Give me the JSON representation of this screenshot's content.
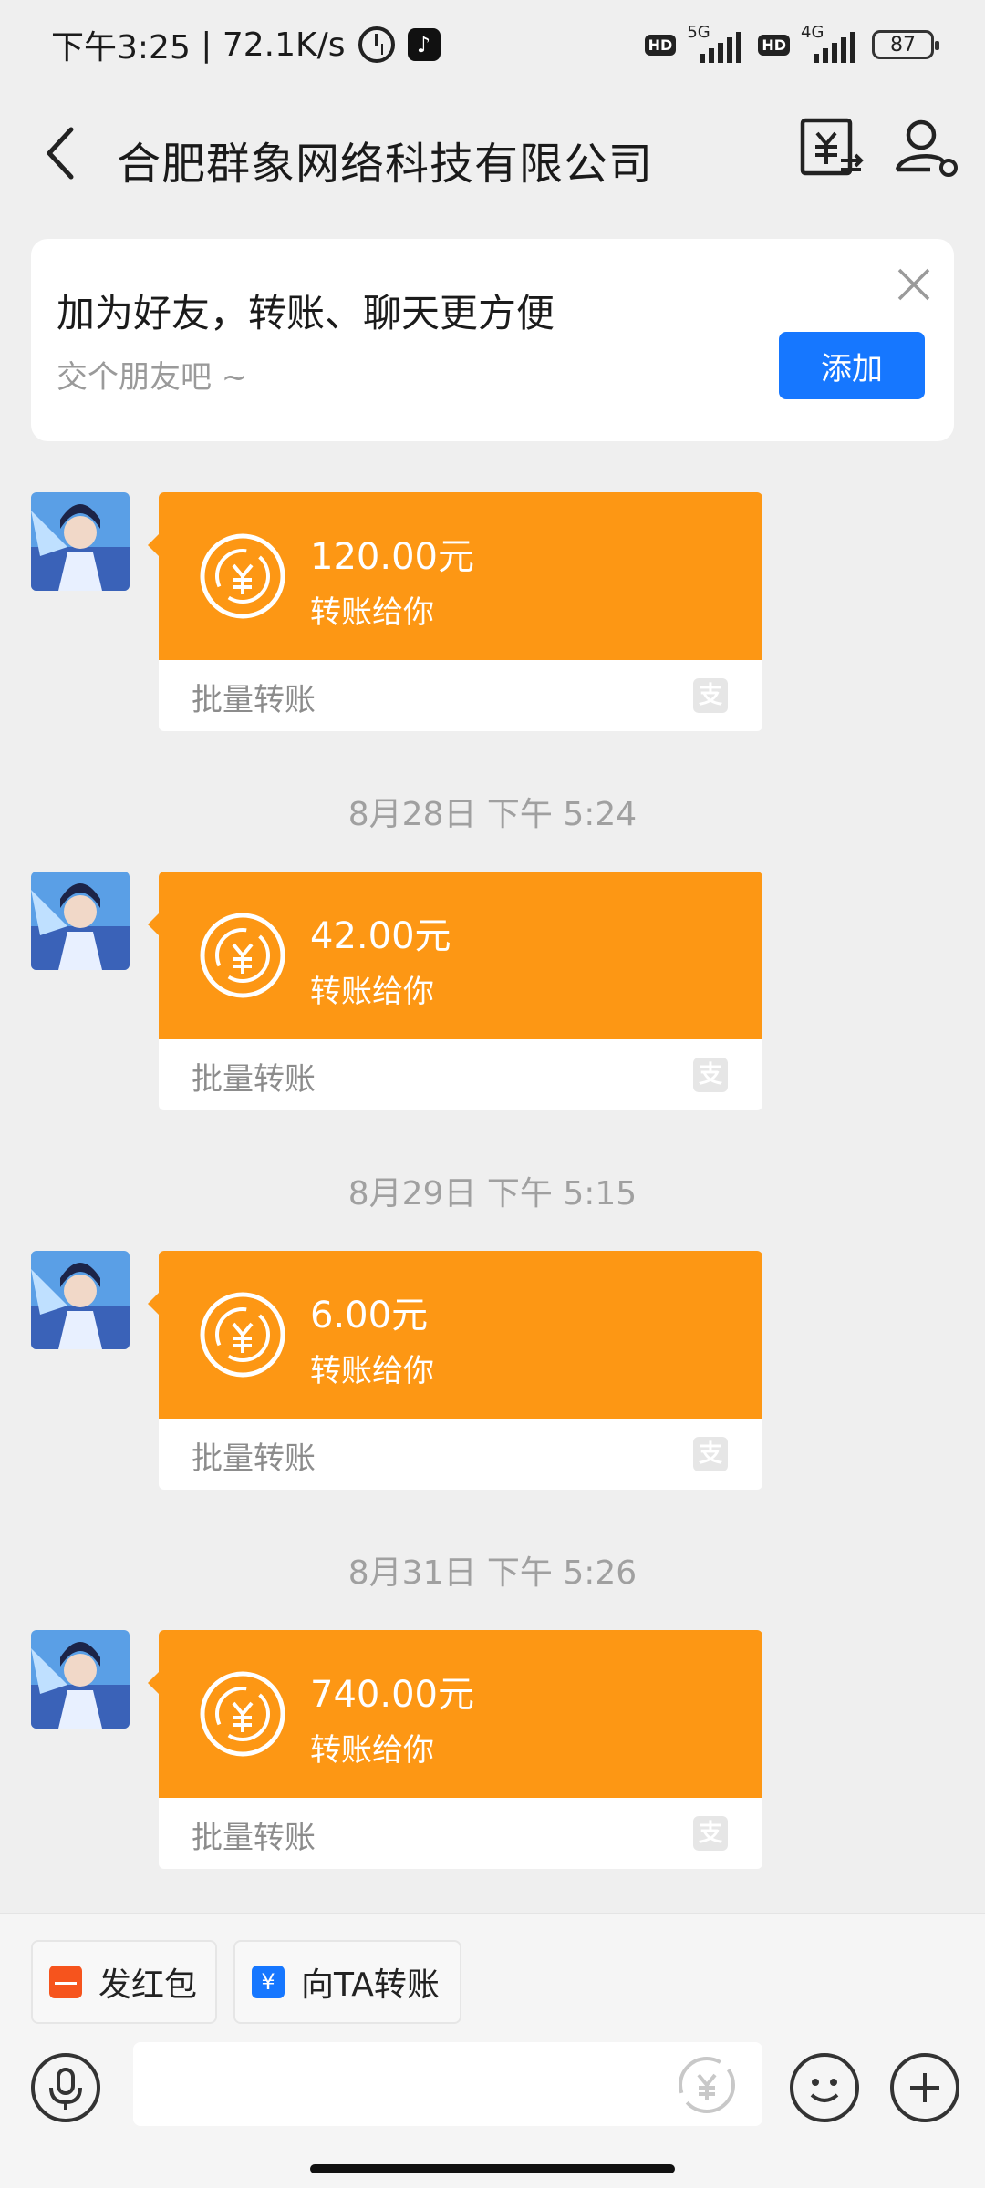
{
  "status_bar": {
    "time": "下午3:25",
    "speed": "72.1K/s",
    "hd1": "HD",
    "net1": "5G",
    "hd2": "HD",
    "net2": "4G",
    "battery": "87"
  },
  "header": {
    "title": "合肥群象网络科技有限公司",
    "back_icon": "back-arrow-icon",
    "transfer_icon": "yen-transfer-icon",
    "profile_icon": "person-settings-icon"
  },
  "friend_card": {
    "title": "加为好友，转账、聊天更方便",
    "subtitle": "交个朋友吧 ~",
    "add_label": "添加",
    "accent": "#1677ff"
  },
  "messages": [
    {
      "amount": "120.00元",
      "desc": "转账给你",
      "footer": "批量转账"
    },
    {
      "timestamp": "8月28日 下午 5:24",
      "amount": "42.00元",
      "desc": "转账给你",
      "footer": "批量转账"
    },
    {
      "timestamp": "8月29日 下午 5:15",
      "amount": "6.00元",
      "desc": "转账给你",
      "footer": "批量转账"
    },
    {
      "timestamp": "8月31日 下午 5:26",
      "amount": "740.00元",
      "desc": "转账给你",
      "footer": "批量转账"
    }
  ],
  "bubble_color": "#fd9714",
  "bottom_bar": {
    "red_packet_label": "发红包",
    "transfer_label": "向TA转账",
    "input_placeholder": ""
  }
}
